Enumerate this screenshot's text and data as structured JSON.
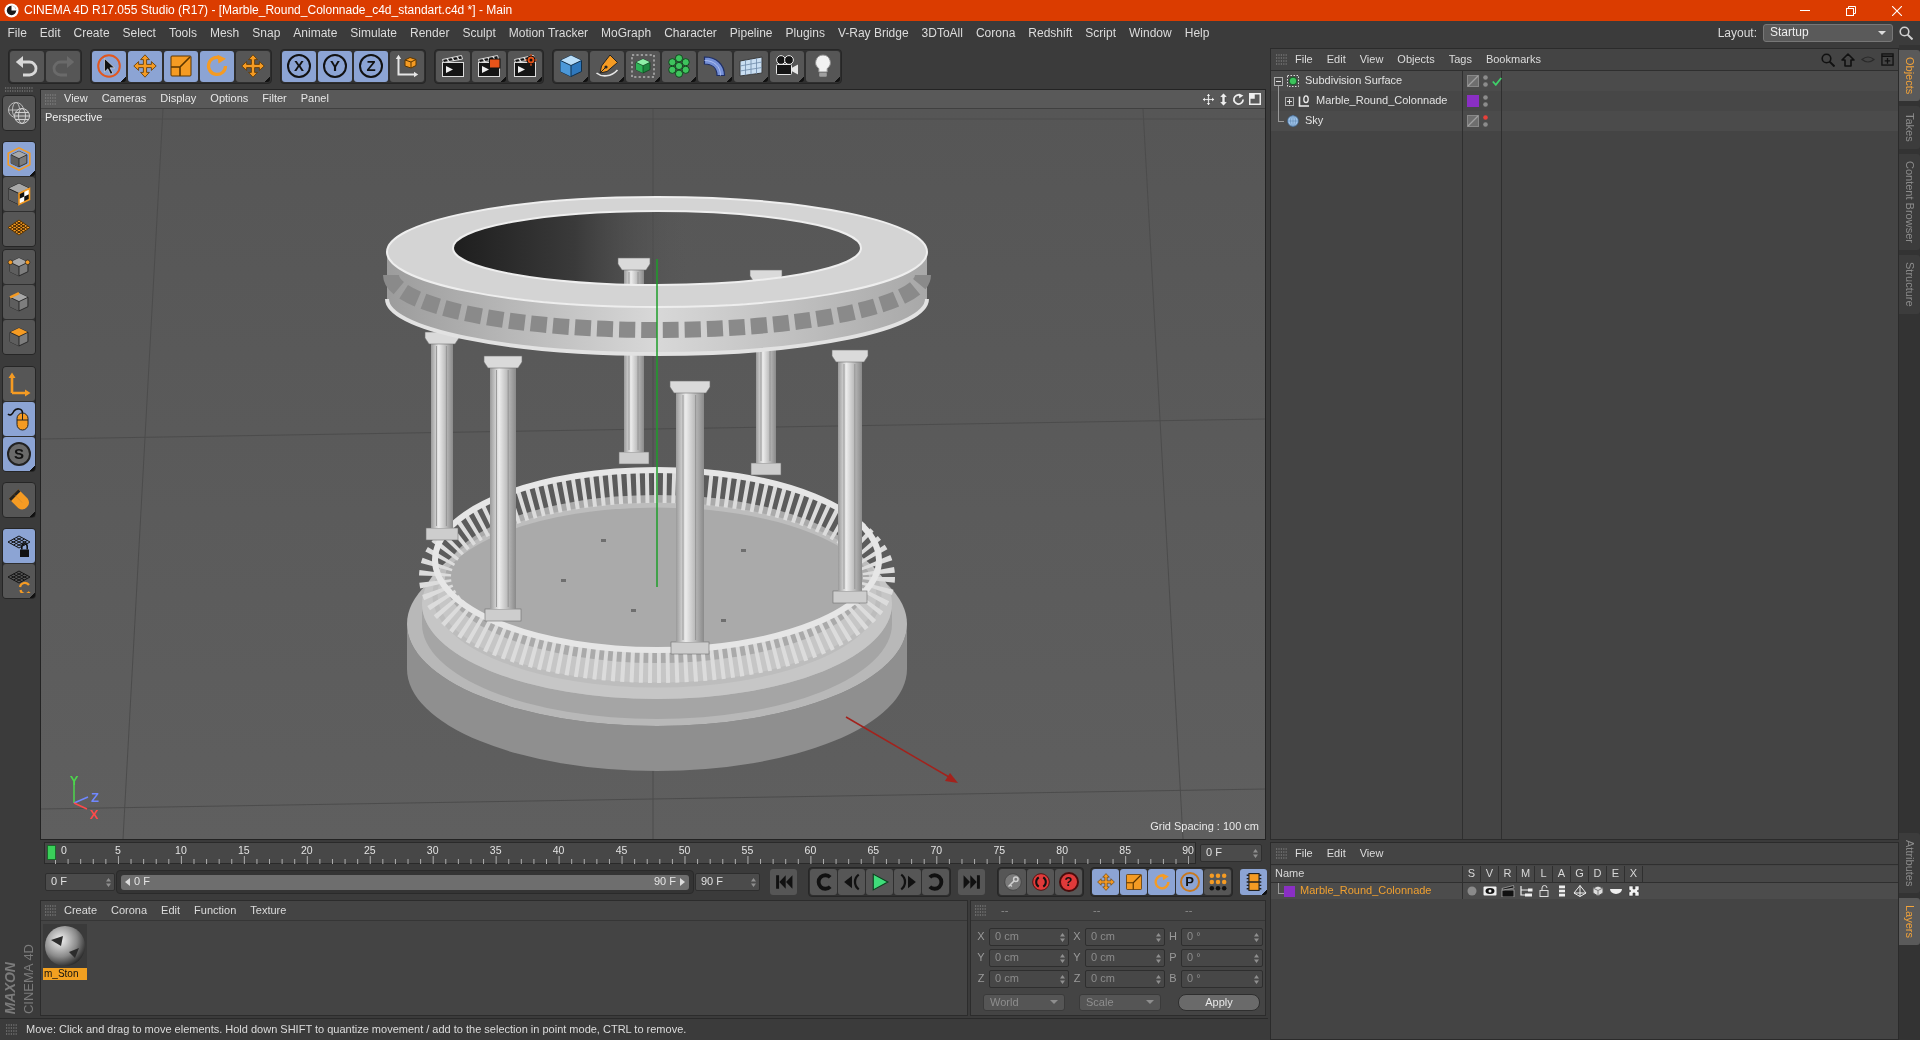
{
  "window": {
    "title": "CINEMA 4D R17.055 Studio (R17) - [Marble_Round_Colonnade_c4d_standart.c4d *] - Main"
  },
  "menu_bar": [
    "File",
    "Edit",
    "Create",
    "Select",
    "Tools",
    "Mesh",
    "Snap",
    "Animate",
    "Simulate",
    "Render",
    "Sculpt",
    "Motion Tracker",
    "MoGraph",
    "Character",
    "Pipeline",
    "Plugins",
    "V-Ray Bridge",
    "3DToAll",
    "Corona",
    "Redshift",
    "Script",
    "Window",
    "Help"
  ],
  "layout": {
    "label": "Layout:",
    "value": "Startup"
  },
  "toolbar": [
    [
      {
        "kind": "undo",
        "disabled": false
      },
      {
        "kind": "redo",
        "disabled": true
      }
    ],
    [
      {
        "kind": "select",
        "active": true
      },
      {
        "kind": "move",
        "active": true
      },
      {
        "kind": "scale",
        "active": true
      },
      {
        "kind": "rotate",
        "active": true
      },
      {
        "kind": "transform",
        "active": false
      }
    ],
    [
      {
        "kind": "axis-lock",
        "label": "X",
        "active": true
      },
      {
        "kind": "axis-lock",
        "label": "Y",
        "active": true
      },
      {
        "kind": "axis-lock",
        "label": "Z",
        "active": true
      },
      {
        "kind": "coordinate-system",
        "active": false
      }
    ],
    [
      {
        "kind": "render-view",
        "active": false
      },
      {
        "kind": "render-picture",
        "active": false
      },
      {
        "kind": "render-settings",
        "active": false
      }
    ],
    [
      {
        "kind": "cube",
        "active": false
      },
      {
        "kind": "pen",
        "active": false
      },
      {
        "kind": "subdivision",
        "active": false
      },
      {
        "kind": "cloner",
        "active": false
      },
      {
        "kind": "bend",
        "active": false
      },
      {
        "kind": "floor",
        "active": false
      },
      {
        "kind": "camera",
        "active": false
      },
      {
        "kind": "light",
        "active": false
      }
    ]
  ],
  "tool_palette": [
    [
      {
        "kind": "make-editable",
        "active": false
      }
    ],
    [
      {
        "kind": "model",
        "active": true
      },
      {
        "kind": "texture",
        "active": false
      },
      {
        "kind": "workplane",
        "active": false
      }
    ],
    [
      {
        "kind": "points",
        "active": false
      },
      {
        "kind": "edges",
        "active": false
      },
      {
        "kind": "polygons",
        "active": false
      }
    ],
    [
      {
        "kind": "axis",
        "active": false
      },
      {
        "kind": "tweak",
        "active": true
      },
      {
        "kind": "solo",
        "label": "S",
        "active": true
      }
    ],
    [
      {
        "kind": "snap",
        "active": false
      }
    ],
    [
      {
        "kind": "lock-workplane",
        "active": true
      },
      {
        "kind": "planar-workplane",
        "active": false
      }
    ]
  ],
  "viewport": {
    "menu": [
      "View",
      "Cameras",
      "Display",
      "Options",
      "Filter",
      "Panel"
    ],
    "camera": "Perspective",
    "grid_spacing": "Grid Spacing : 100 cm",
    "axis_labels": [
      {
        "label": "Y",
        "color": "#4cd64c"
      },
      {
        "label": "Z",
        "color": "#7088ff"
      },
      {
        "label": "X",
        "color": "#ff4a4a"
      }
    ]
  },
  "timeline": {
    "ticks": [
      "0",
      "5",
      "10",
      "15",
      "20",
      "25",
      "30",
      "35",
      "40",
      "45",
      "50",
      "55",
      "60",
      "65",
      "70",
      "75",
      "80",
      "85",
      "90"
    ],
    "level": 0,
    "frame": "0 F"
  },
  "transport": {
    "start": "0 F",
    "range": {
      "start": "0 F",
      "end": "90 F",
      "level": 1
    },
    "end": "90 F",
    "record": [
      {
        "kind": "keyframe"
      },
      {
        "kind": "record"
      },
      {
        "kind": "autokey",
        "label": "?"
      }
    ],
    "key_tools": [
      {
        "kind": "move",
        "active": true
      },
      {
        "kind": "scale",
        "active": true
      },
      {
        "kind": "rotate",
        "active": true
      },
      {
        "kind": "parameter",
        "label": "P",
        "active": true
      },
      {
        "kind": "point-level",
        "active": false
      }
    ],
    "timeline_toggle": {
      "active": true
    }
  },
  "materials": {
    "menu": [
      "Create",
      "Corona",
      "Edit",
      "Function",
      "Texture"
    ],
    "items": [
      {
        "name": "m_Ston",
        "selected": true
      }
    ]
  },
  "coordinates": {
    "headers": [
      "--",
      "--",
      "--"
    ],
    "rows": [
      {
        "axis": "X",
        "position": "0 cm",
        "size_axis": "X",
        "size": "0 cm",
        "angle_axis": "H",
        "angle": "0 °"
      },
      {
        "axis": "Y",
        "position": "0 cm",
        "size_axis": "Y",
        "size": "0 cm",
        "angle_axis": "P",
        "angle": "0 °"
      },
      {
        "axis": "Z",
        "position": "0 cm",
        "size_axis": "Z",
        "size": "0 cm",
        "angle_axis": "B",
        "angle": "0 °"
      }
    ],
    "mode": "World",
    "size_mode": "Scale",
    "apply": "Apply"
  },
  "status_bar": "Move: Click and drag to move elements. Hold down SHIFT to quantize movement / add to the selection in point mode, CTRL to remove.",
  "logo": {
    "brand": "MAXON",
    "product": "CINEMA 4D"
  },
  "object_manager": {
    "menu": [
      "File",
      "Edit",
      "View",
      "Objects",
      "Tags",
      "Bookmarks"
    ],
    "objects": [
      {
        "kind": "subdivision",
        "name": "Subdivision Surface",
        "expanded": true,
        "editor_hidden": false,
        "enabled": true,
        "children": [
          {
            "kind": "null",
            "name": "Marble_Round_Colonnade",
            "expanded": false,
            "color": "#8a2fc4",
            "editor_hidden": false
          }
        ]
      },
      {
        "kind": "sky",
        "name": "Sky",
        "editor_hidden": true
      }
    ]
  },
  "layer_manager": {
    "menu": [
      "File",
      "Edit",
      "View"
    ],
    "columns": [
      "Name",
      "S",
      "V",
      "R",
      "M",
      "L",
      "A",
      "G",
      "D",
      "E",
      "X"
    ],
    "layers": [
      {
        "name": "Marble_Round_Colonnade",
        "color": "#8a2fc4"
      }
    ]
  },
  "side_tabs": {
    "top": [
      {
        "label": "Objects",
        "selected": true
      },
      {
        "label": "Takes",
        "selected": false
      },
      {
        "label": "Content Browser",
        "selected": false
      },
      {
        "label": "Structure",
        "selected": false
      }
    ],
    "bottom": [
      {
        "label": "Attributes",
        "selected": false
      },
      {
        "label": "Layers",
        "selected": true
      }
    ]
  }
}
